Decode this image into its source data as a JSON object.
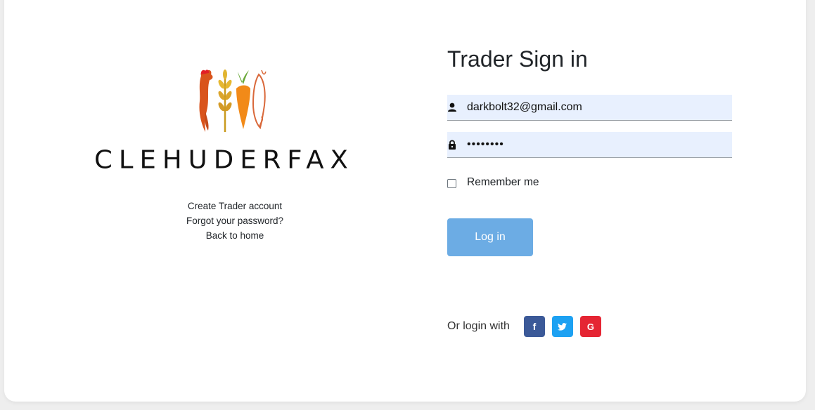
{
  "brand": {
    "name": "CLEHUDERFAX",
    "logo_icon": "farm-produce-logo-icon"
  },
  "left_links": [
    {
      "label": "Create Trader account"
    },
    {
      "label": "Forgot your password?"
    },
    {
      "label": "Back to home"
    }
  ],
  "form": {
    "title": "Trader Sign in",
    "email_value": "darkbolt32@gmail.com",
    "password_value": "••••••••",
    "remember_label": "Remember me",
    "remember_checked": false,
    "login_label": "Log in"
  },
  "social": {
    "label": "Or login with",
    "buttons": [
      {
        "name": "facebook",
        "glyph": "f",
        "color": "#3b5998"
      },
      {
        "name": "twitter",
        "glyph": "t",
        "color": "#1da1f2"
      },
      {
        "name": "google",
        "glyph": "G",
        "color": "#e52533"
      }
    ]
  },
  "colors": {
    "input_bg": "#e8f0fe",
    "login_button": "#6cace4"
  }
}
